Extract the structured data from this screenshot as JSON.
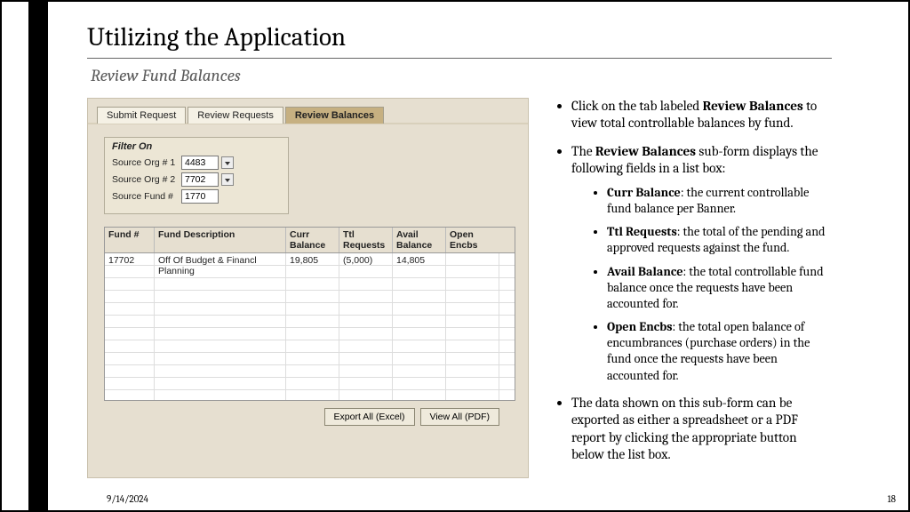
{
  "title": "Utilizing the Application",
  "subtitle": "Review Fund Balances",
  "footer": {
    "date": "9/14/2024",
    "page": "18"
  },
  "app": {
    "tabs": [
      "Submit Request",
      "Review Requests",
      "Review Balances"
    ],
    "active_tab": 2,
    "filter": {
      "title": "Filter On",
      "rows": [
        {
          "label": "Source Org # 1",
          "value": "4483",
          "dropdown": true
        },
        {
          "label": "Source Org # 2",
          "value": "7702",
          "dropdown": true
        },
        {
          "label": "Source Fund #",
          "value": "1770",
          "dropdown": false
        }
      ]
    },
    "columns": [
      "Fund #",
      "Fund Description",
      "Curr Balance",
      "Ttl Requests",
      "Avail Balance",
      "Open Encbs"
    ],
    "rows": [
      {
        "fund": "17702",
        "desc": "Off Of Budget & Financl Planning",
        "curr": "19,805",
        "ttl": "(5,000)",
        "avail": "14,805",
        "open": ""
      }
    ],
    "buttons": {
      "export": "Export All (Excel)",
      "view": "View All (PDF)"
    }
  },
  "bulletsHTML": [
    "Click on the tab labeled <b>Review Balances</b> to view total controllable balances by fund.",
    "The <b>Review Balances</b> sub-form displays the following fields in a list box:",
    "The data shown on this sub-form can be exported as either a spreadsheet or a PDF report by clicking the appropriate button below the list box."
  ],
  "innerBulletsHTML": [
    "<b>Curr Balance</b>: the current controllable fund balance per Banner.",
    "<b>Ttl Requests</b>: the total of the pending and approved requests against the fund.",
    "<b>Avail Balance</b>: the total controllable fund balance once the requests have been accounted for.",
    "<b>Open Encbs</b>: the total open balance of encumbrances (purchase orders) in the fund once the requests have been accounted for."
  ]
}
